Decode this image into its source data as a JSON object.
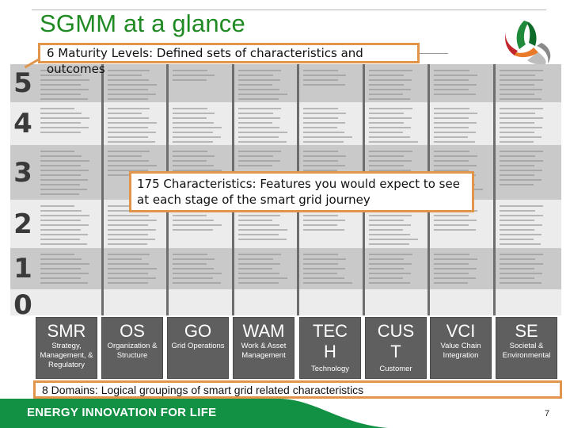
{
  "slide": {
    "title": "SGMM at a glance",
    "page_number": "7",
    "tagline": "ENERGY INNOVATION FOR LIFE",
    "colors": {
      "title_green": "#1f8a22",
      "callout_border": "#e0954a",
      "domain_box": "#5f5f5f",
      "footer_green": "#129145"
    }
  },
  "callouts": {
    "levels": "6 Maturity Levels: Defined sets of characteristics and outcomes",
    "characteristics": "175 Characteristics: Features you would expect to see at each stage of the smart grid journey",
    "domains": "8 Domains: Logical groupings of smart grid related characteristics"
  },
  "levels": [
    {
      "label": "5",
      "shade": "#c9c9c9"
    },
    {
      "label": "4",
      "shade": "#ececec"
    },
    {
      "label": "3",
      "shade": "#c9c9c9"
    },
    {
      "label": "2",
      "shade": "#ececec"
    },
    {
      "label": "1",
      "shade": "#c9c9c9"
    },
    {
      "label": "0",
      "shade": "#ececec"
    }
  ],
  "domains": [
    {
      "abbr": "SMR",
      "name": "Strategy, Management, & Regulatory"
    },
    {
      "abbr": "OS",
      "name": "Organization & Structure"
    },
    {
      "abbr": "GO",
      "name": "Grid Operations"
    },
    {
      "abbr": "WAM",
      "name": "Work & Asset Management"
    },
    {
      "abbr": "TEC H",
      "name": "Technology"
    },
    {
      "abbr": "CUS T",
      "name": "Customer"
    },
    {
      "abbr": "VCI",
      "name": "Value Chain Integration"
    },
    {
      "abbr": "SE",
      "name": "Societal & Environmental"
    }
  ],
  "logo": {
    "icon": "sgmm-tri-swirl-logo"
  }
}
